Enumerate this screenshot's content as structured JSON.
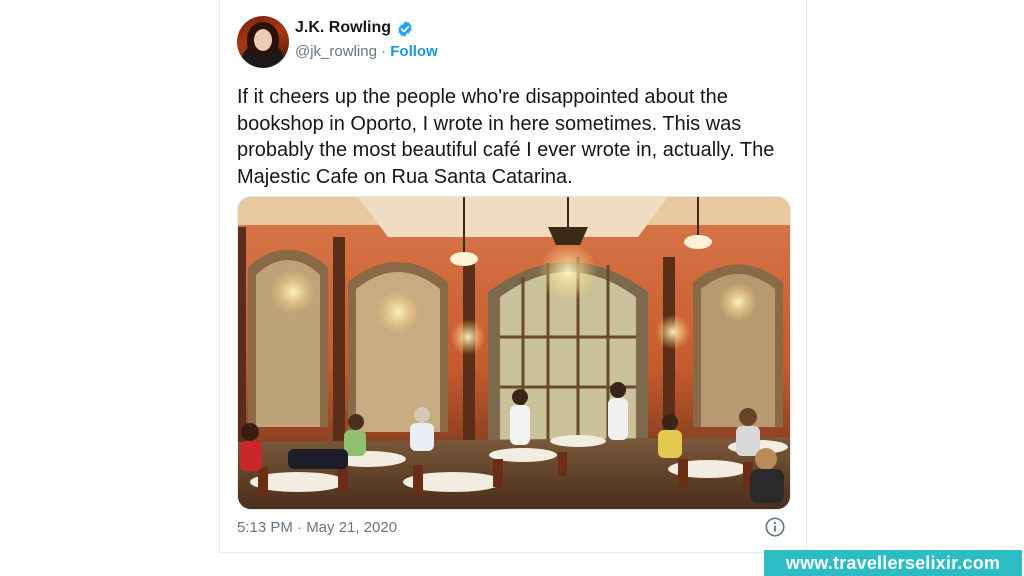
{
  "tweet": {
    "author_name": "J.K. Rowling",
    "handle": "@jk_rowling",
    "separator": "·",
    "follow_label": "Follow",
    "text": "If it cheers up the people who're disappointed about the bookshop in Oporto, I wrote in here sometimes. This was probably the most beautiful café I ever wrote in, actually. The Majestic Cafe on Rua Santa Catarina.",
    "timestamp": "5:13 PM · May 21, 2020"
  },
  "icons": {
    "verified": "verified-badge-icon",
    "info": "info-icon"
  },
  "watermark": {
    "text": "www.travellerselixir.com"
  },
  "colors": {
    "follow": "#1b95e0",
    "verified": "#1da1f2",
    "watermark_bg": "#2bbcc4",
    "secondary_text": "#657786"
  }
}
